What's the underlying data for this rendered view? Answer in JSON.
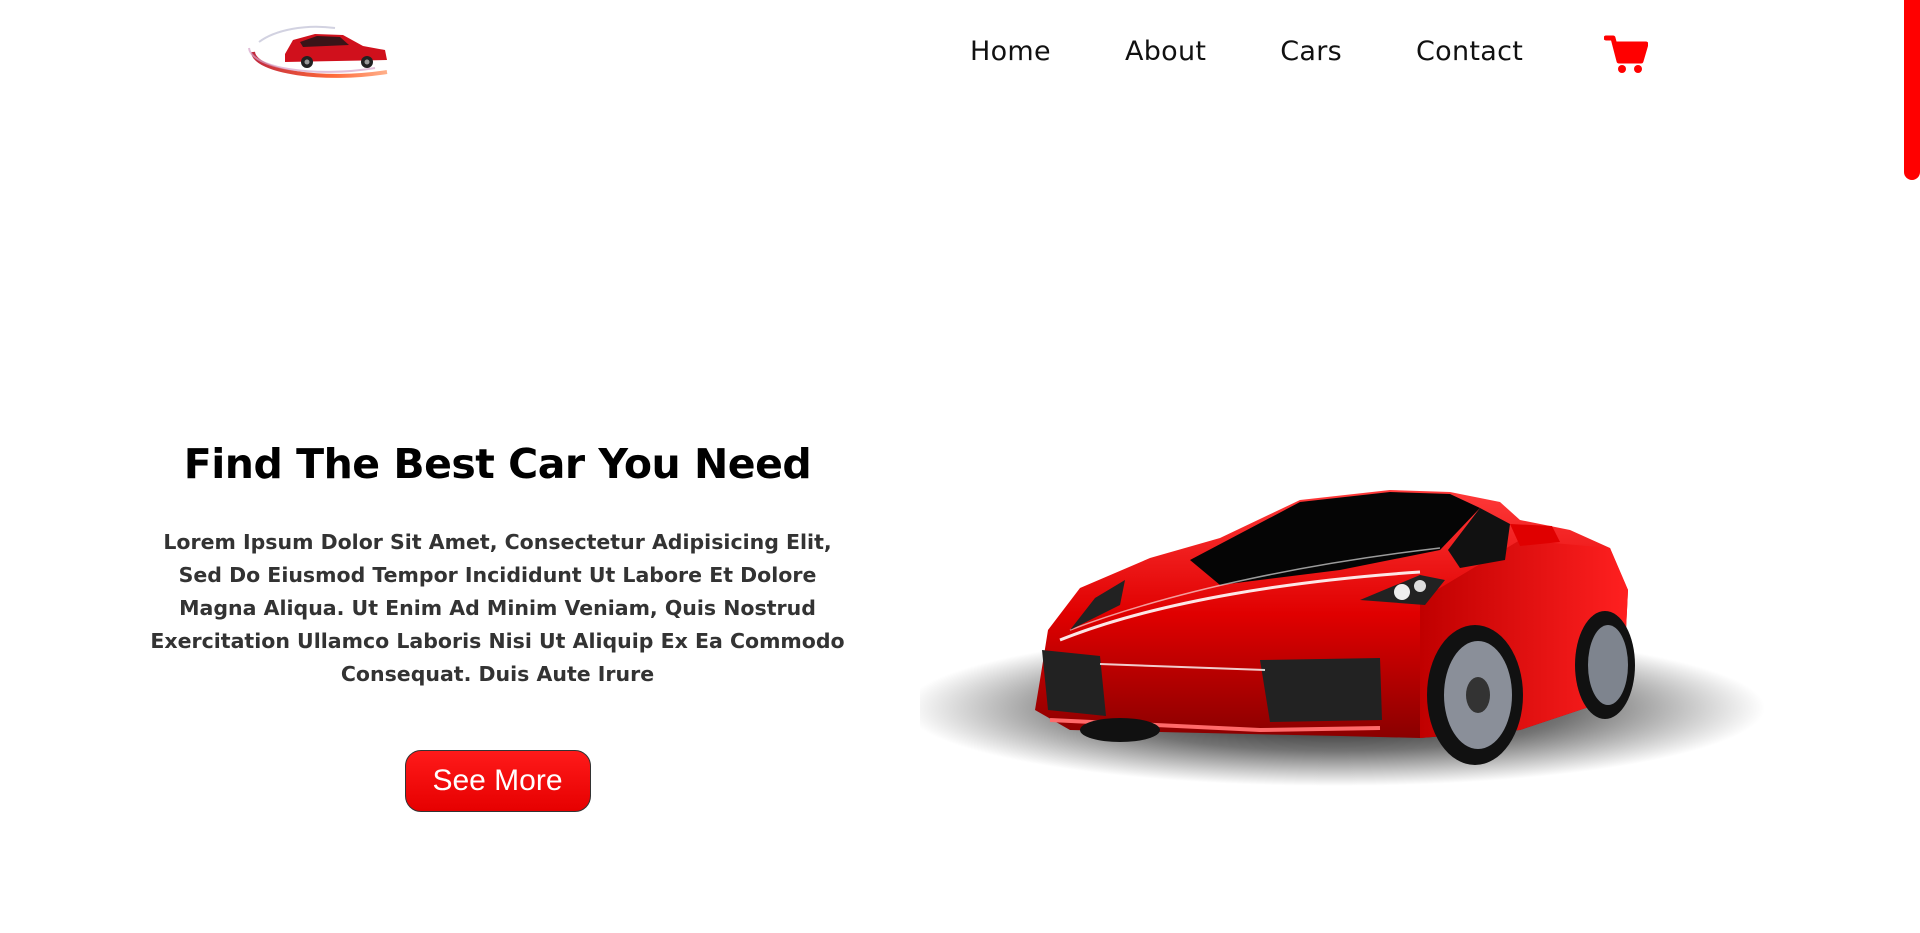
{
  "header": {
    "logo_alt": "logo",
    "nav": [
      {
        "label": "Home"
      },
      {
        "label": "About"
      },
      {
        "label": "Cars"
      },
      {
        "label": "Contact"
      }
    ],
    "cart_icon": "shopping-cart-icon"
  },
  "hero": {
    "title": "Find The Best Car You Need",
    "description": "Lorem Ipsum Dolor Sit Amet, Consectetur Adipisicing Elit, Sed Do Eiusmod Tempor Incididunt Ut Labore Et Dolore Magna Aliqua. Ut Enim Ad Minim Veniam, Quis Nostrud Exercitation Ullamco Laboris Nisi Ut Aliquip Ex Ea Commodo Consequat. Duis Aute Irure",
    "button_label": "See More"
  },
  "colors": {
    "accent": "#ff0000",
    "text": "#111111",
    "background": "#ffffff"
  }
}
